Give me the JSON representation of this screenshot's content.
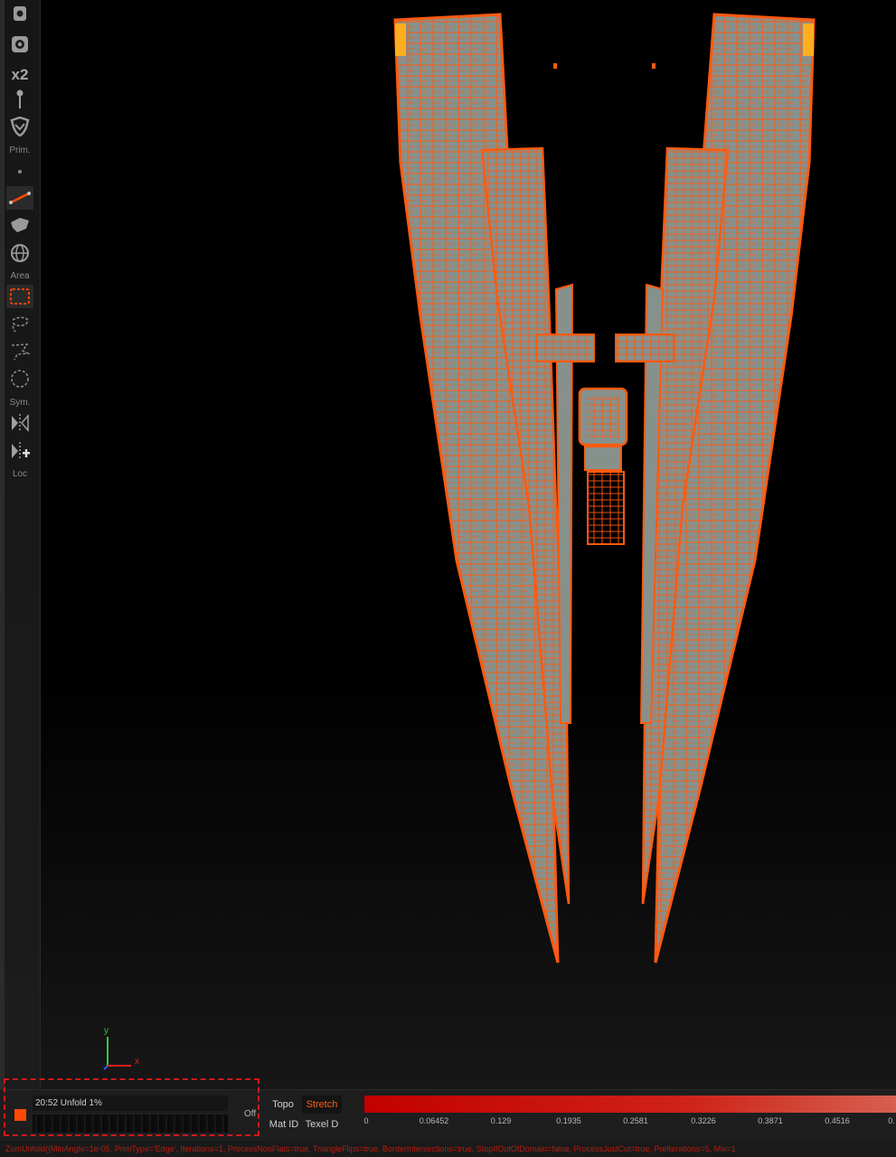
{
  "toolbar": {
    "icons": [
      "lock-icon",
      "camera-icon",
      "double-icon",
      "pin-icon",
      "shield-icon",
      "dot-icon",
      "edge-select-icon",
      "move-icon",
      "globe-icon",
      "rect-select-icon",
      "lasso-icon",
      "polygon-lasso-icon",
      "circle-select-icon",
      "mirror-icon",
      "mirror-add-icon"
    ],
    "x2_label": "x2",
    "prim_label": "Prim.",
    "area_label": "Area",
    "sym_label": "Sym.",
    "loc_label": "Loc",
    "accent_color": "#ff4a06"
  },
  "viewport": {
    "axis_y_label": "y",
    "axis_x_label": "x",
    "uv_fill_color": "#87918c",
    "uv_edge_color": "#ff5a10"
  },
  "status": {
    "task_text": "20:52 Unfold 1%",
    "toggle_label": "Off"
  },
  "display_modes": {
    "topo": "Topo",
    "stretch": "Stretch",
    "mat_id": "Mat ID",
    "texel_d": "Texel D"
  },
  "legend": {
    "ticks": [
      "0",
      "0.06452",
      "0.129",
      "0.1935",
      "0.2581",
      "0.3226",
      "0.3871",
      "0.4516",
      "0."
    ]
  },
  "command_line": "ZomUnfold({MinAngle=1e-05, PrimType='Edge', Iterations=1, ProcessNonFlats=true, TriangleFlips=true, BorderIntersections=true, StopIfOutOfDomain=false, ProcessJustCut=true, PreIterations=5, Mix=1"
}
